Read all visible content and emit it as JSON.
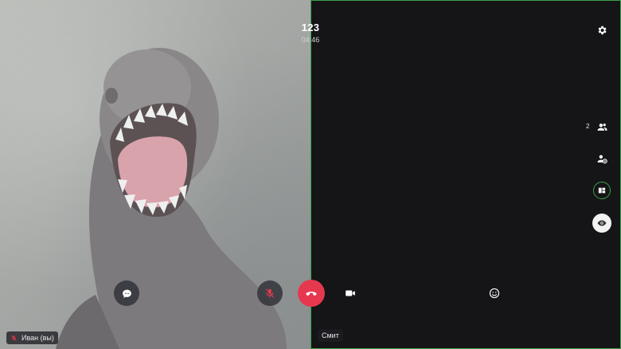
{
  "call": {
    "title": "123",
    "timer": "04:46"
  },
  "participants": {
    "local_name": "Иван (вы)",
    "remote_name": "Смит"
  },
  "sidebar": {
    "participants_count": "2",
    "icons": [
      "gear-icon",
      "people-icon",
      "add-person-icon",
      "layout-icon",
      "eye-icon"
    ]
  },
  "controls": {
    "icons": [
      "chat-icon",
      "mic-off-icon",
      "hangup-icon",
      "camera-icon",
      "emoji-icon"
    ]
  },
  "colors": {
    "hangup": "#e5384f",
    "active_border": "#3aa04a",
    "mic_off": "#e5384f"
  }
}
